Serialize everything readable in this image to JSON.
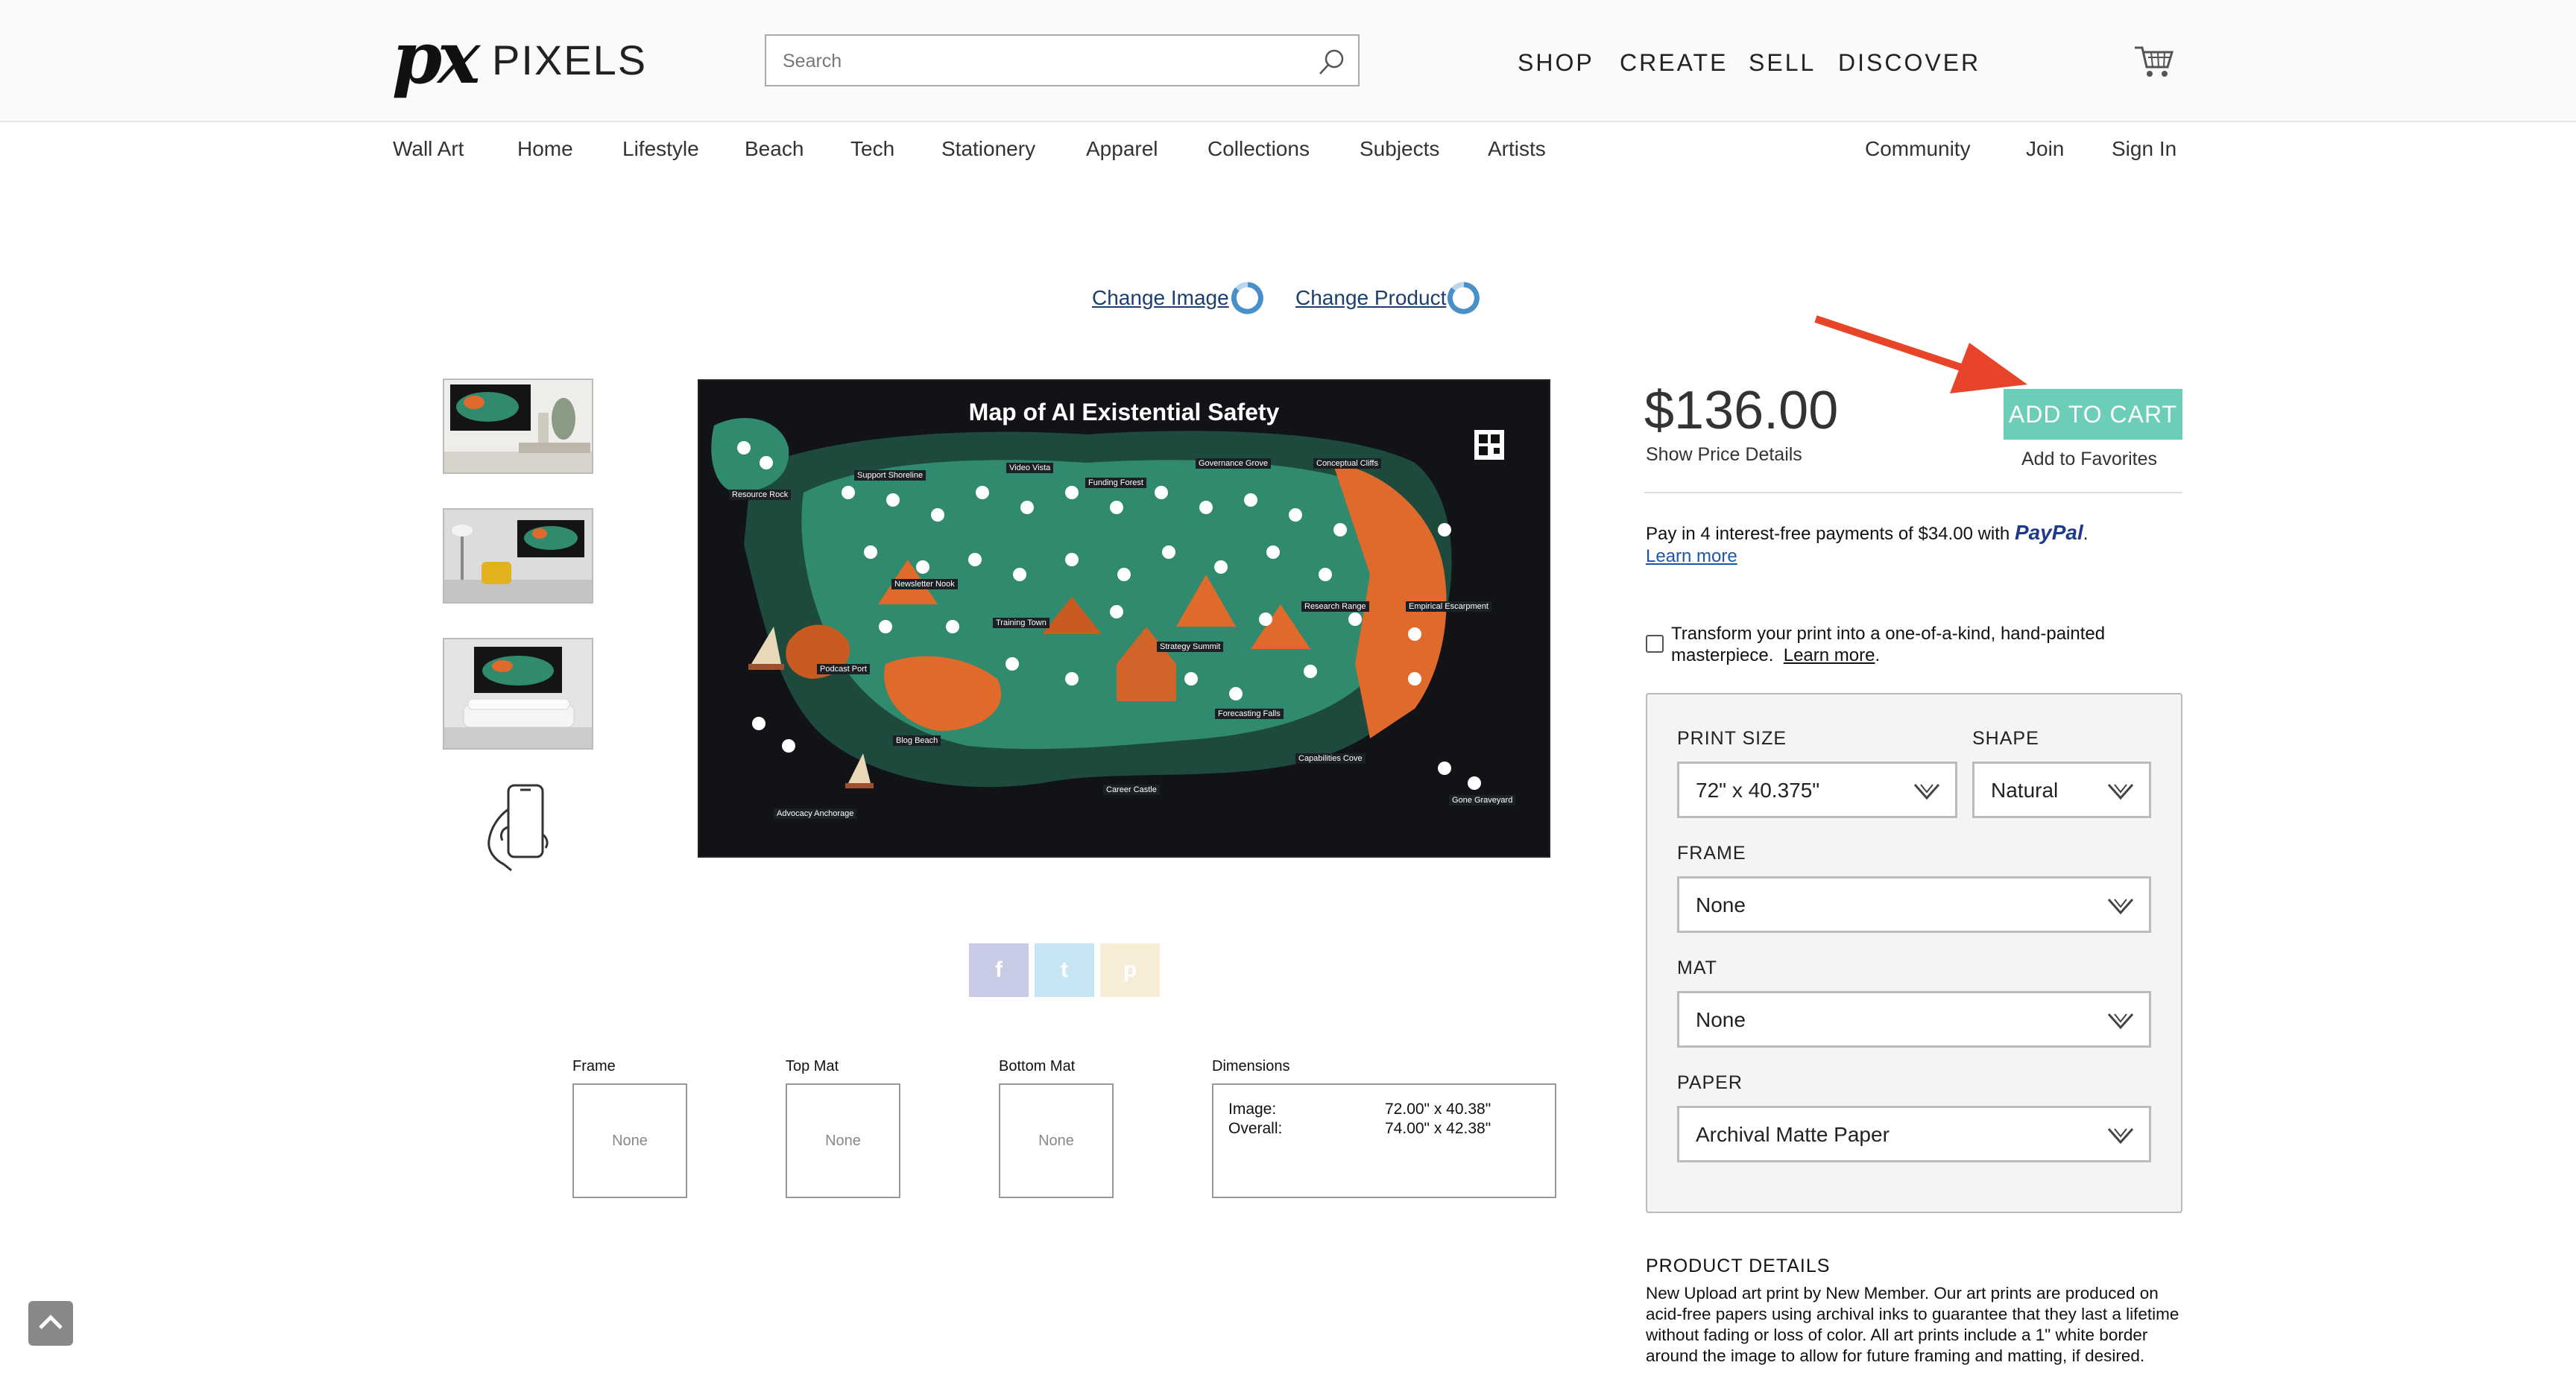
{
  "header": {
    "logo_mark": "px",
    "logo_text": "PIXELS",
    "search_placeholder": "Search",
    "nav": [
      "SHOP",
      "CREATE",
      "SELL",
      "DISCOVER"
    ]
  },
  "categories": [
    "Wall Art",
    "Home",
    "Lifestyle",
    "Beach",
    "Tech",
    "Stationery",
    "Apparel",
    "Collections",
    "Subjects",
    "Artists"
  ],
  "account_links": [
    "Community",
    "Join",
    "Sign In"
  ],
  "change_links": {
    "image": "Change Image",
    "product": "Change Product"
  },
  "artwork": {
    "title": "Map of AI Existential Safety",
    "labels": [
      "Support Shoreline",
      "Video Vista",
      "Funding Forest",
      "Governance Grove",
      "Conceptual Cliffs",
      "Resource Rock",
      "Newsletter Nook",
      "Research Range",
      "Empirical Escarpment",
      "Training Town",
      "Strategy Summit",
      "Podcast Port",
      "Blog Beach",
      "Forecasting Falls",
      "Capabilities Cove",
      "Career Castle",
      "Gone Graveyard",
      "Advocacy Anchorage"
    ]
  },
  "product": {
    "price": "$136.00",
    "show_price_details": "Show Price Details",
    "add_to_cart": "ADD TO CART",
    "add_to_favorites": "Add to Favorites",
    "paypal_text": "Pay in 4 interest-free payments of $34.00 with",
    "paypal_brand": "PayPal",
    "paypal_period": ".",
    "learn_more": "Learn more",
    "transform_text": "Transform your print into a one-of-a-kind, hand-painted masterpiece.",
    "transform_checked": false
  },
  "options": {
    "print_size_label": "PRINT SIZE",
    "print_size_value": "72\" x 40.375\"",
    "shape_label": "SHAPE",
    "shape_value": "Natural",
    "frame_label": "FRAME",
    "frame_value": "None",
    "mat_label": "MAT",
    "mat_value": "None",
    "paper_label": "PAPER",
    "paper_value": "Archival Matte Paper"
  },
  "details": {
    "title": "PRODUCT DETAILS",
    "text": "New Upload art print by New Member.   Our art prints are produced on acid-free papers using archival inks to guarantee that they last a lifetime without fading or loss of color. All art prints include a 1\" white border around the image to allow for future framing and matting, if desired."
  },
  "summary": {
    "frame_label": "Frame",
    "top_mat_label": "Top Mat",
    "bottom_mat_label": "Bottom Mat",
    "dimensions_label": "Dimensions",
    "none": "None",
    "image_label": "Image:",
    "image_value": "72.00\" x 40.38\"",
    "overall_label": "Overall:",
    "overall_value": "74.00\" x 42.38\""
  },
  "social": {
    "facebook": "f",
    "twitter": "t",
    "pinterest": "p"
  },
  "colors": {
    "accent": "#6ccdb8",
    "arrow": "#e8442a",
    "link": "#1d3f6e",
    "map_bg": "#111317",
    "map_green": "#2f8a6e",
    "map_orange": "#e06a2c"
  }
}
